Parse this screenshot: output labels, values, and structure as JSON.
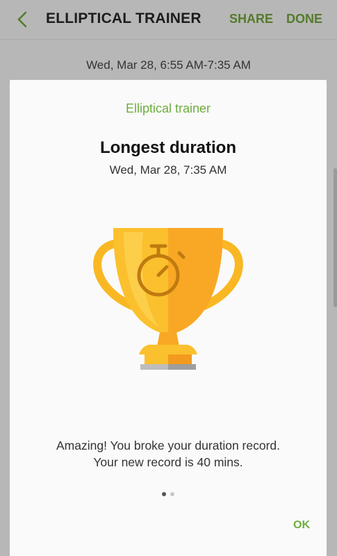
{
  "header": {
    "title": "ELLIPTICAL TRAINER",
    "share_label": "SHARE",
    "done_label": "DONE",
    "back_icon": "chevron-left-icon"
  },
  "session": {
    "date_range": "Wed, Mar 28, 6:55 AM-7:35 AM"
  },
  "dialog": {
    "header": "Elliptical trainer",
    "title": "Longest duration",
    "date": "Wed, Mar 28, 7:35 AM",
    "illustration": "trophy-stopwatch-icon",
    "message_line1": "Amazing! You broke your duration record.",
    "message_line2": "Your new record is 40 mins.",
    "page_index": 1,
    "page_count": 2,
    "ok_label": "OK"
  },
  "colors": {
    "accent": "#6fae3f",
    "action": "#557a2b",
    "trophy_gold": "#fbc02d"
  }
}
